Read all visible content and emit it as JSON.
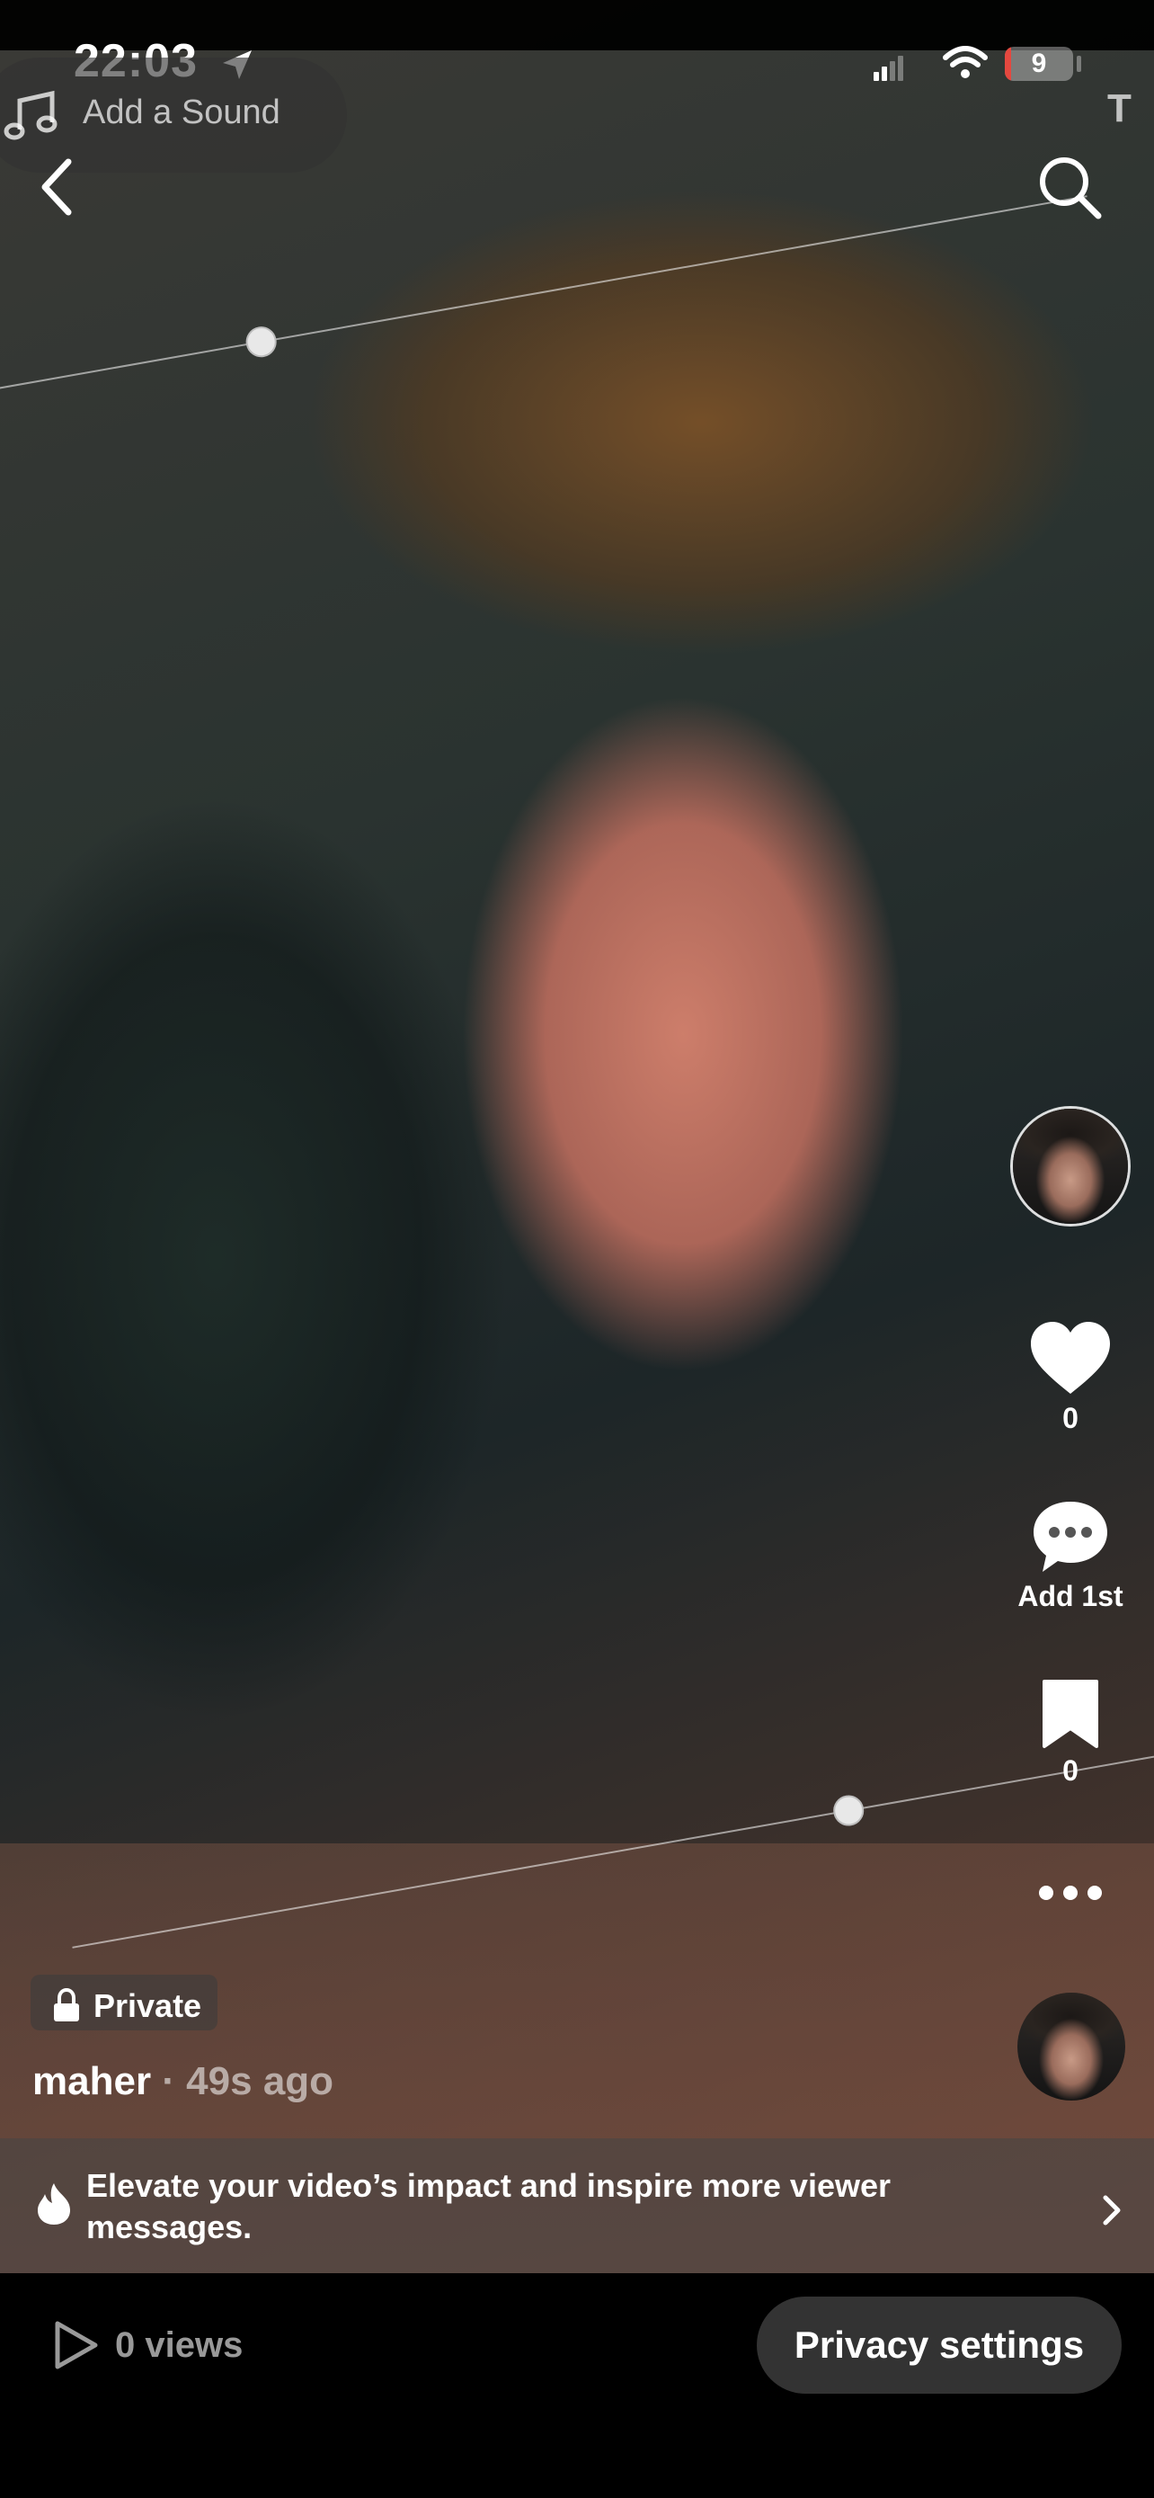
{
  "status_bar": {
    "time": "22:03",
    "battery": "9",
    "battery_level": 0.09
  },
  "sound": {
    "label": "Add a Sound"
  },
  "corner_text": "T",
  "actions": {
    "like_count": "0",
    "comment_label": "Add 1st",
    "save_count": "0"
  },
  "post": {
    "privacy_badge": "Private",
    "author": "maher",
    "time": " · 49s ago"
  },
  "promo": {
    "text": "Elevate your video’s impact and inspire more viewer messages."
  },
  "footer": {
    "views": "0 views",
    "privacy_button": "Privacy settings"
  }
}
